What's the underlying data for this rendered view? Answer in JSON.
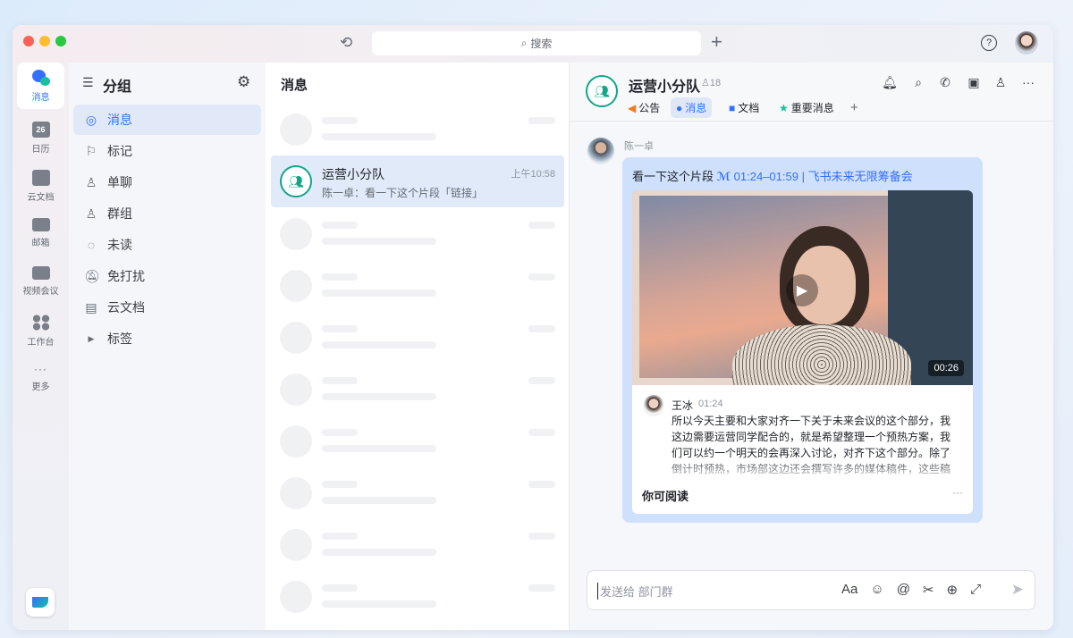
{
  "titlebar": {
    "search_placeholder": "搜索",
    "icons": [
      "history-icon",
      "add-icon",
      "help-icon",
      "avatar"
    ]
  },
  "rail": {
    "items": [
      {
        "label": "消息",
        "active": true
      },
      {
        "label": "日历",
        "badge": "26"
      },
      {
        "label": "云文档"
      },
      {
        "label": "邮箱"
      },
      {
        "label": "视频会议"
      },
      {
        "label": "工作台"
      },
      {
        "label": "更多"
      }
    ]
  },
  "groups": {
    "title": "分组",
    "items": [
      {
        "label": "消息",
        "icon": "chat-icon",
        "active": true
      },
      {
        "label": "标记",
        "icon": "flag-icon"
      },
      {
        "label": "单聊",
        "icon": "user-icon"
      },
      {
        "label": "群组",
        "icon": "group-icon"
      },
      {
        "label": "未读",
        "icon": "unread-icon"
      },
      {
        "label": "免打扰",
        "icon": "mute-icon"
      },
      {
        "label": "云文档",
        "icon": "doc-icon"
      },
      {
        "label": "标签",
        "icon": "caret-right-icon"
      }
    ]
  },
  "list": {
    "title": "消息",
    "active_chat": {
      "name": "运营小分队",
      "time": "上午10:58",
      "preview": "陈一卓：看一下这个片段「链接」"
    }
  },
  "chat": {
    "name": "运营小分队",
    "member_count": "18",
    "tabs": [
      {
        "label": "公告",
        "color": "#f5791f"
      },
      {
        "label": "消息",
        "color": "#3370ff",
        "active": true
      },
      {
        "label": "文档",
        "color": "#3370ff"
      },
      {
        "label": "重要消息",
        "color": "#14c0a0"
      }
    ],
    "add_tab": "+",
    "message": {
      "sender": "陈一卓",
      "text": "看一下这个片段",
      "link": "01:24–01:59 | 飞书未来无限筹备会",
      "video_duration": "00:26",
      "transcript": {
        "speaker": "王冰",
        "time": "01:24",
        "text": "所以今天主要和大家对齐一下关于未来会议的这个部分，我这边需要运营同学配合的，就是希望整理一个预热方案，我们可以约一个明天的会再深入讨论，对齐下这个部分。除了倒计时预热，市场部这边还会撰写许多的媒体稿件，这些稿件会分阶段进行发"
      },
      "footer": "你可阅读",
      "more": "···"
    },
    "input_placeholder": "发送给 部门群",
    "input_tools": [
      "Aa",
      "☺",
      "@",
      "✂",
      "⊕",
      "⤢"
    ]
  }
}
